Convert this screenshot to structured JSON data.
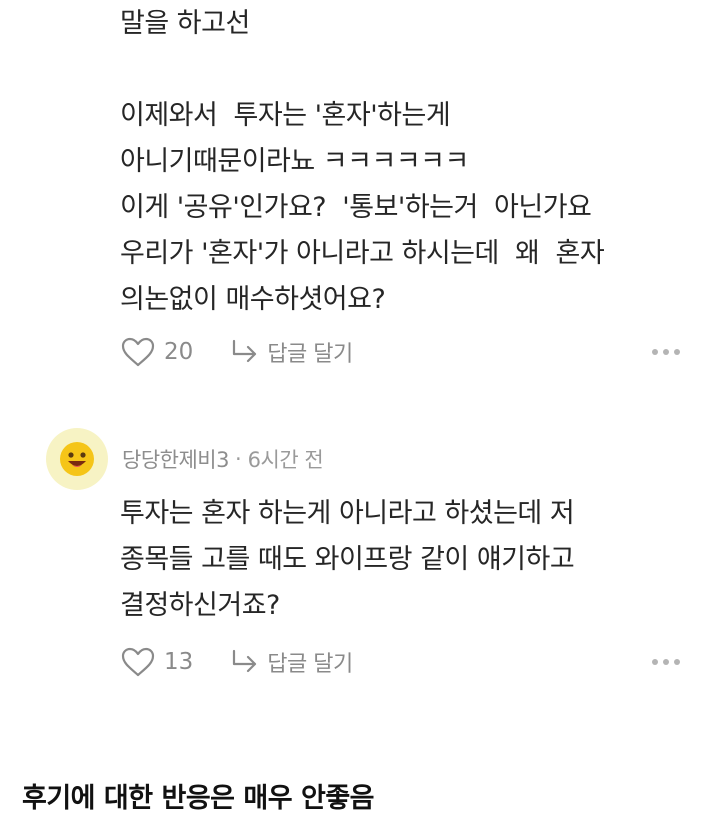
{
  "comment1": {
    "lines": [
      "말을 하고선",
      "",
      "이제와서  투자는 '혼자'하는게",
      "아니기때문이라뇨 ㅋㅋㅋㅋㅋㅋ",
      "이게 '공유'인가요?  '통보'하는거  아닌가요",
      "우리가 '혼자'가 아니라고 하시는데  왜  혼자",
      "의논없이 매수하셧어요?"
    ],
    "like_count": "20",
    "reply_label": "답글 달기"
  },
  "comment2": {
    "author": "당당한제비3",
    "separator": "·",
    "time": "6시간 전",
    "lines": [
      "투자는 혼자 하는게 아니라고 하셨는데 저",
      "종목들 고를 때도 와이프랑 같이 얘기하고",
      "결정하신거죠?"
    ],
    "like_count": "13",
    "reply_label": "답글 달기"
  },
  "footer_title": "후기에 대한 반응은 매우 안좋음",
  "icons": {
    "like": "heart-outline-icon",
    "reply": "reply-arrow-icon",
    "more": "more-dots-icon",
    "avatar": "smiley-face-icon"
  },
  "colors": {
    "text": "#262626",
    "muted": "#8a8a8a",
    "avatar_bg": "#f7f3c4",
    "avatar_face": "#f5c518"
  }
}
